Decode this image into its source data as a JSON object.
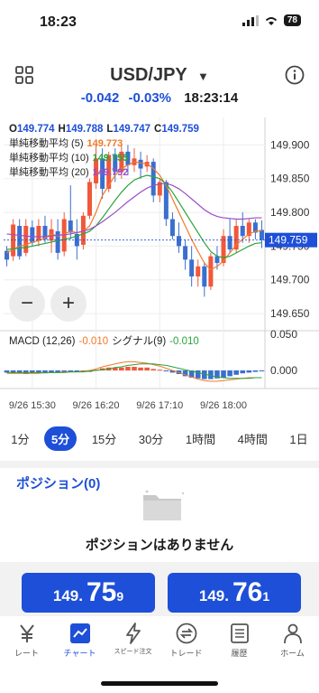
{
  "status_bar": {
    "time": "18:23",
    "battery": "78"
  },
  "header": {
    "title": "USD/JPY",
    "change": "-0.042",
    "change_pct": "-0.03%",
    "time": "18:23:14"
  },
  "chart": {
    "ohlc": {
      "open": "149.774",
      "high": "149.788",
      "low": "149.747",
      "close": "149.759"
    },
    "ohlc_labels": {
      "open": "O",
      "high": "H",
      "low": "L",
      "close": "C"
    },
    "indicators": [
      {
        "label": "単純移動平均 (5)",
        "value": "149.773",
        "color": "#f07a28"
      },
      {
        "label": "単純移動平均 (10)",
        "value": "149.755",
        "color": "#2aa33c"
      },
      {
        "label": "単純移動平均 (20)",
        "value": "149.792",
        "color": "#9a4fc8"
      }
    ],
    "y_ticks": [
      "149.900",
      "149.850",
      "149.800",
      "149.750",
      "149.700",
      "149.650"
    ],
    "current_price_label": "149.759",
    "macd": {
      "label": "MACD (12,26)",
      "value": "-0.010",
      "signal_label": "シグナル(9)",
      "signal_value": "-0.010",
      "y_ticks": [
        "0.050",
        "0.000"
      ]
    },
    "x_ticks": [
      "9/26 15:30",
      "9/26 16:20",
      "9/26 17:10",
      "9/26 18:00"
    ],
    "zoom_out": "−",
    "zoom_in": "+",
    "colors": {
      "up": "#f0583a",
      "down": "#3a6fd0",
      "price_tag": "#1e4fd8"
    }
  },
  "timeframes": [
    "1分",
    "5分",
    "15分",
    "30分",
    "1時間",
    "4時間",
    "1日"
  ],
  "active_timeframe": "5分",
  "positions": {
    "title": "ポジション(0)",
    "empty": "ポジションはありません"
  },
  "prices": {
    "bid": {
      "prefix": "149.",
      "main": "75",
      "suffix": "9"
    },
    "ask": {
      "prefix": "149.",
      "main": "76",
      "suffix": "1"
    }
  },
  "tabs": [
    {
      "label": "レート",
      "icon": "yen-icon"
    },
    {
      "label": "チャート",
      "icon": "chart-icon"
    },
    {
      "label": "スピード注文",
      "icon": "lightning-icon"
    },
    {
      "label": "トレード",
      "icon": "exchange-icon"
    },
    {
      "label": "履歴",
      "icon": "history-icon"
    },
    {
      "label": "ホーム",
      "icon": "user-icon"
    }
  ],
  "chart_data": {
    "type": "candlestick",
    "y_range": [
      149.63,
      149.93
    ],
    "candles": [
      {
        "o": 149.743,
        "h": 149.75,
        "l": 149.72,
        "c": 149.73
      },
      {
        "o": 149.735,
        "h": 149.79,
        "l": 149.728,
        "c": 149.782
      },
      {
        "o": 149.78,
        "h": 149.79,
        "l": 149.73,
        "c": 149.735
      },
      {
        "o": 149.74,
        "h": 149.79,
        "l": 149.735,
        "c": 149.78
      },
      {
        "o": 149.778,
        "h": 149.788,
        "l": 149.75,
        "c": 149.755
      },
      {
        "o": 149.758,
        "h": 149.79,
        "l": 149.75,
        "c": 149.78
      },
      {
        "o": 149.78,
        "h": 149.795,
        "l": 149.755,
        "c": 149.76
      },
      {
        "o": 149.758,
        "h": 149.79,
        "l": 149.74,
        "c": 149.775
      },
      {
        "o": 149.772,
        "h": 149.79,
        "l": 149.73,
        "c": 149.74
      },
      {
        "o": 149.742,
        "h": 149.8,
        "l": 149.735,
        "c": 149.79
      },
      {
        "o": 149.788,
        "h": 149.84,
        "l": 149.76,
        "c": 149.77
      },
      {
        "o": 149.768,
        "h": 149.79,
        "l": 149.73,
        "c": 149.75
      },
      {
        "o": 149.752,
        "h": 149.8,
        "l": 149.745,
        "c": 149.795
      },
      {
        "o": 149.795,
        "h": 149.85,
        "l": 149.79,
        "c": 149.845
      },
      {
        "o": 149.843,
        "h": 149.9,
        "l": 149.835,
        "c": 149.88
      },
      {
        "o": 149.88,
        "h": 149.895,
        "l": 149.82,
        "c": 149.835
      },
      {
        "o": 149.835,
        "h": 149.89,
        "l": 149.83,
        "c": 149.885
      },
      {
        "o": 149.885,
        "h": 149.895,
        "l": 149.845,
        "c": 149.86
      },
      {
        "o": 149.86,
        "h": 149.9,
        "l": 149.85,
        "c": 149.89
      },
      {
        "o": 149.89,
        "h": 149.9,
        "l": 149.855,
        "c": 149.87
      },
      {
        "o": 149.87,
        "h": 149.895,
        "l": 149.86,
        "c": 149.88
      },
      {
        "o": 149.878,
        "h": 149.89,
        "l": 149.85,
        "c": 149.865
      },
      {
        "o": 149.868,
        "h": 149.885,
        "l": 149.86,
        "c": 149.875
      },
      {
        "o": 149.875,
        "h": 149.88,
        "l": 149.815,
        "c": 149.825
      },
      {
        "o": 149.825,
        "h": 149.85,
        "l": 149.815,
        "c": 149.845
      },
      {
        "o": 149.845,
        "h": 149.848,
        "l": 149.78,
        "c": 149.79
      },
      {
        "o": 149.79,
        "h": 149.8,
        "l": 149.76,
        "c": 149.765
      },
      {
        "o": 149.765,
        "h": 149.785,
        "l": 149.74,
        "c": 149.75
      },
      {
        "o": 149.75,
        "h": 149.76,
        "l": 149.715,
        "c": 149.73
      },
      {
        "o": 149.73,
        "h": 149.75,
        "l": 149.69,
        "c": 149.705
      },
      {
        "o": 149.705,
        "h": 149.73,
        "l": 149.69,
        "c": 149.72
      },
      {
        "o": 149.72,
        "h": 149.725,
        "l": 149.675,
        "c": 149.69
      },
      {
        "o": 149.69,
        "h": 149.74,
        "l": 149.685,
        "c": 149.735
      },
      {
        "o": 149.735,
        "h": 149.75,
        "l": 149.715,
        "c": 149.725
      },
      {
        "o": 149.725,
        "h": 149.775,
        "l": 149.72,
        "c": 149.765
      },
      {
        "o": 149.765,
        "h": 149.79,
        "l": 149.74,
        "c": 149.745
      },
      {
        "o": 149.745,
        "h": 149.79,
        "l": 149.74,
        "c": 149.78
      },
      {
        "o": 149.78,
        "h": 149.8,
        "l": 149.755,
        "c": 149.765
      },
      {
        "o": 149.765,
        "h": 149.79,
        "l": 149.755,
        "c": 149.785
      },
      {
        "o": 149.785,
        "h": 149.79,
        "l": 149.76,
        "c": 149.77
      },
      {
        "o": 149.774,
        "h": 149.788,
        "l": 149.747,
        "c": 149.759
      }
    ],
    "sma5": [
      149.74,
      149.745,
      149.75,
      149.752,
      149.756,
      149.758,
      149.762,
      149.768,
      149.765,
      149.768,
      149.772,
      149.77,
      149.772,
      149.78,
      149.8,
      149.825,
      149.84,
      149.855,
      149.865,
      149.87,
      149.875,
      149.873,
      149.872,
      149.865,
      149.855,
      149.84,
      149.82,
      149.8,
      149.78,
      149.76,
      149.742,
      149.725,
      149.715,
      149.72,
      149.728,
      149.74,
      149.752,
      149.76,
      149.768,
      149.772,
      149.773
    ],
    "sma10": [
      149.745,
      149.746,
      149.747,
      149.748,
      149.75,
      149.752,
      149.754,
      149.756,
      149.758,
      149.76,
      149.762,
      149.765,
      149.768,
      149.772,
      149.78,
      149.792,
      149.805,
      149.818,
      149.83,
      149.84,
      149.848,
      149.852,
      149.855,
      149.853,
      149.85,
      149.842,
      149.83,
      149.815,
      149.8,
      149.785,
      149.77,
      149.755,
      149.742,
      149.735,
      149.733,
      149.735,
      149.74,
      149.745,
      149.75,
      149.754,
      149.755
    ],
    "sma20": [
      149.768,
      149.767,
      149.766,
      149.765,
      149.764,
      149.764,
      149.764,
      149.765,
      149.766,
      149.767,
      149.768,
      149.77,
      149.772,
      149.775,
      149.78,
      149.786,
      149.793,
      149.8,
      149.808,
      149.816,
      149.823,
      149.83,
      149.836,
      149.84,
      149.842,
      149.843,
      149.84,
      149.835,
      149.828,
      149.82,
      149.812,
      149.804,
      149.798,
      149.794,
      149.792,
      149.791,
      149.79,
      149.79,
      149.791,
      149.792,
      149.792
    ],
    "macd_hist": [
      -0.003,
      -0.004,
      -0.004,
      -0.005,
      -0.004,
      -0.004,
      -0.004,
      -0.003,
      -0.003,
      -0.002,
      -0.002,
      -0.002,
      -0.002,
      -0.002,
      0.001,
      0.003,
      0.004,
      0.004,
      0.004,
      0.005,
      0.005,
      0.004,
      0.004,
      0.002,
      0.001,
      -0.001,
      -0.003,
      -0.005,
      -0.008,
      -0.01,
      -0.011,
      -0.012,
      -0.012,
      -0.011,
      -0.01,
      -0.008,
      -0.006,
      -0.004,
      -0.003,
      -0.002,
      -0.001
    ],
    "macd_line": [
      -0.004,
      -0.004,
      -0.004,
      -0.004,
      -0.004,
      -0.004,
      -0.003,
      -0.003,
      -0.003,
      -0.002,
      -0.002,
      -0.002,
      -0.001,
      0.0,
      0.002,
      0.005,
      0.007,
      0.009,
      0.011,
      0.012,
      0.012,
      0.011,
      0.01,
      0.008,
      0.006,
      0.003,
      0.0,
      -0.003,
      -0.006,
      -0.009,
      -0.012,
      -0.014,
      -0.015,
      -0.015,
      -0.014,
      -0.013,
      -0.012,
      -0.011,
      -0.01,
      -0.01,
      -0.01
    ],
    "signal_line": [
      -0.003,
      -0.003,
      -0.003,
      -0.003,
      -0.003,
      -0.003,
      -0.003,
      -0.003,
      -0.003,
      -0.003,
      -0.002,
      -0.002,
      -0.002,
      -0.001,
      0.0,
      0.001,
      0.002,
      0.004,
      0.005,
      0.007,
      0.008,
      0.009,
      0.009,
      0.009,
      0.008,
      0.007,
      0.005,
      0.003,
      0.001,
      -0.001,
      -0.003,
      -0.005,
      -0.007,
      -0.009,
      -0.01,
      -0.011,
      -0.011,
      -0.011,
      -0.011,
      -0.01,
      -0.01
    ],
    "macd_range": [
      -0.025,
      0.05
    ]
  }
}
